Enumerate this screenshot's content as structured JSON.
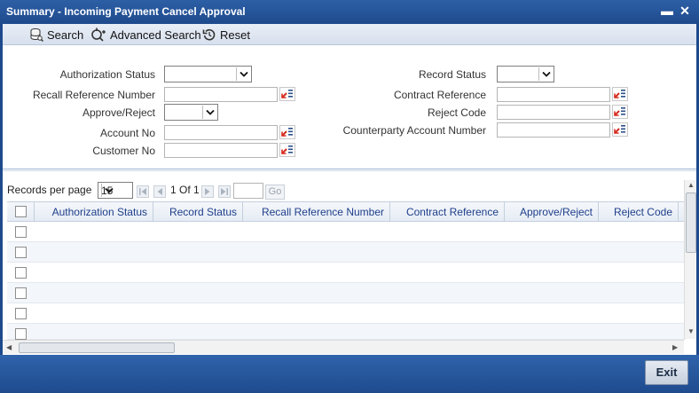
{
  "window": {
    "title": "Summary - Incoming Payment Cancel Approval",
    "minimize": "▬",
    "close": "✕"
  },
  "toolbar": {
    "search": "Search",
    "advanced_search": "Advanced Search",
    "reset": "Reset"
  },
  "form": {
    "authorization_status": {
      "label": "Authorization Status",
      "value": ""
    },
    "recall_reference_number": {
      "label": "Recall Reference Number",
      "value": ""
    },
    "approve_reject": {
      "label": "Approve/Reject",
      "value": ""
    },
    "account_no": {
      "label": "Account No",
      "value": ""
    },
    "customer_no": {
      "label": "Customer No",
      "value": ""
    },
    "record_status": {
      "label": "Record Status",
      "value": ""
    },
    "contract_reference": {
      "label": "Contract Reference",
      "value": ""
    },
    "reject_code": {
      "label": "Reject Code",
      "value": ""
    },
    "counterparty_account_number": {
      "label": "Counterparty Account Number",
      "value": ""
    }
  },
  "pager": {
    "records_per_page_label": "Records per page",
    "records_per_page": "15",
    "page_info": "1 Of 1",
    "go": "Go"
  },
  "table": {
    "columns": [
      "Authorization Status",
      "Record Status",
      "Recall Reference Number",
      "Contract Reference",
      "Approve/Reject",
      "Reject Code"
    ],
    "rows": [
      {},
      {},
      {},
      {},
      {},
      {}
    ]
  },
  "footer": {
    "exit": "Exit"
  }
}
